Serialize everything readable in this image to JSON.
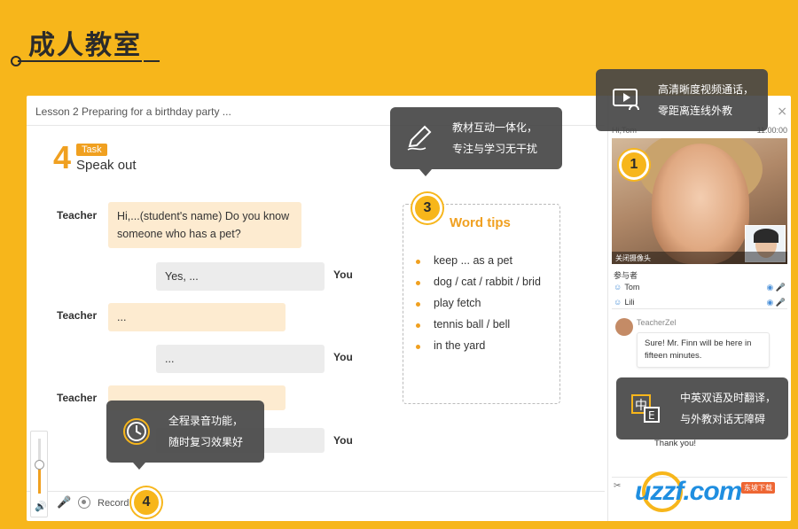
{
  "header": {
    "title": "成人教室"
  },
  "lesson": {
    "title": "Lesson 2  Preparing for a birthday party ...",
    "task_number": "4",
    "task_tag": "Task",
    "task_name": "Speak out"
  },
  "dialogue": [
    {
      "speaker": "Teacher",
      "text": "Hi,...(student's name) Do you know someone who has a pet?"
    },
    {
      "speaker": "You",
      "text": "Yes, ..."
    },
    {
      "speaker": "Teacher",
      "text": "..."
    },
    {
      "speaker": "You",
      "text": "..."
    },
    {
      "speaker": "Teacher",
      "text": ""
    },
    {
      "speaker": "You",
      "text": ""
    }
  ],
  "word_tips": {
    "title": "Word tips",
    "items": [
      "keep ... as a pet",
      "dog / cat / rabbit / brid",
      "play fetch",
      "tennis ball / bell",
      "in the yard"
    ]
  },
  "right_panel": {
    "close": "×",
    "video_header": "Hi,Tom",
    "video_time": "11:00:00",
    "video_control": "关闭摄像头",
    "participants_label": "参与者",
    "participants": [
      "Tom",
      "Lili"
    ],
    "chat_name": "TeacherZel",
    "chat_message": "Sure! Mr. Finn will be here in fifteen minutes.",
    "chat_reply": "Thank you!"
  },
  "controls": {
    "record_label": "Record"
  },
  "tooltips": {
    "video": [
      "高清晰度视频通话，",
      "零距离连线外教"
    ],
    "material": [
      "教材互动一体化，",
      "专注与学习无干扰"
    ],
    "translate": [
      "中英双语及时翻译，",
      "与外教对话无障碍"
    ],
    "record": [
      "全程录音功能，",
      "随时复习效果好"
    ]
  },
  "markers": [
    "1",
    "3",
    "4"
  ],
  "watermark": {
    "text": "uzzf.com",
    "sub": "东坡下载"
  },
  "colors": {
    "accent": "#f7b61b",
    "orange": "#f0a020",
    "tooltip_bg": "#464646"
  }
}
